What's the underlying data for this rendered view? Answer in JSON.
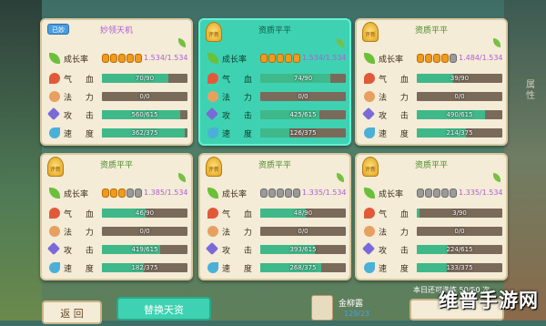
{
  "labels": {
    "growth": "成长率",
    "hp": "气 血",
    "mp": "法 力",
    "atk": "攻 击",
    "spd": "速 度"
  },
  "side_text": "属\n性",
  "cards": [
    {
      "header": "妙领天机",
      "badge": "已妙",
      "growth": "1.534/1.534",
      "pills": [
        1,
        1,
        1,
        1,
        1
      ],
      "hp": "70/90",
      "hp_frac": 0.78,
      "mp": "0/0",
      "mp_frac": 0,
      "atk": "560/615",
      "atk_frac": 0.91,
      "spd": "362/375",
      "spd_frac": 0.97
    },
    {
      "header": "资质平平",
      "badge": "评新",
      "growth": "1.534/1.534",
      "pills": [
        1,
        1,
        1,
        1,
        1
      ],
      "hp": "74/90",
      "hp_frac": 0.82,
      "mp": "0/0",
      "mp_frac": 0,
      "atk": "425/615",
      "atk_frac": 0.69,
      "spd": "126/375",
      "spd_frac": 0.34
    },
    {
      "header": "资质平平",
      "badge": "评新",
      "growth": "1.484/1.534",
      "pills": [
        1,
        1,
        1,
        1,
        0
      ],
      "hp": "39/90",
      "hp_frac": 0.43,
      "mp": "0/0",
      "mp_frac": 0,
      "atk": "490/615",
      "atk_frac": 0.8,
      "spd": "214/375",
      "spd_frac": 0.57
    },
    {
      "header": "资质平平",
      "badge": "评新",
      "growth": "1.385/1.534",
      "pills": [
        1,
        1,
        1,
        0,
        0
      ],
      "hp": "46/90",
      "hp_frac": 0.51,
      "mp": "0/0",
      "mp_frac": 0,
      "atk": "419/615",
      "atk_frac": 0.68,
      "spd": "182/375",
      "spd_frac": 0.49
    },
    {
      "header": "资质平平",
      "badge": "评新",
      "growth": "1.335/1.534",
      "pills": [
        0,
        0,
        0,
        0,
        0
      ],
      "hp": "48/90",
      "hp_frac": 0.53,
      "mp": "0/0",
      "mp_frac": 0,
      "atk": "393/615",
      "atk_frac": 0.64,
      "spd": "268/375",
      "spd_frac": 0.71
    },
    {
      "header": "资质平平",
      "badge": "评新",
      "growth": "1.335/1.534",
      "pills": [
        0,
        0,
        0,
        0,
        0
      ],
      "hp": "3/90",
      "hp_frac": 0.03,
      "mp": "0/0",
      "mp_frac": 0,
      "atk": "224/615",
      "atk_frac": 0.36,
      "spd": "133/375",
      "spd_frac": 0.35
    }
  ],
  "bottom": {
    "back": "返 回",
    "swap": "替换天资",
    "item_name": "金柳露",
    "item_count": "129/23",
    "daily": "本日还可洗练 50/50 次"
  },
  "watermark": "维普手游网"
}
